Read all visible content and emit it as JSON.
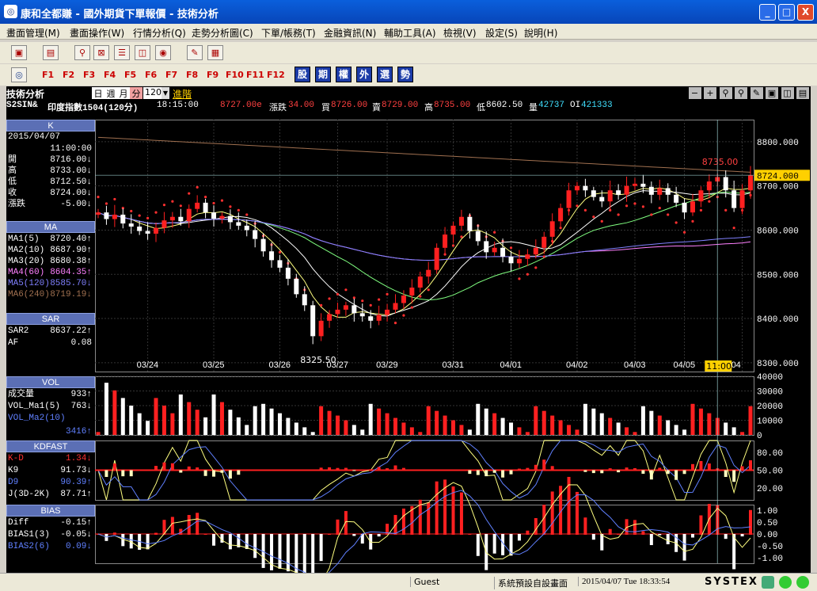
{
  "window": {
    "title": "康和全都賺 - 國外期貨下單報價 - 技術分析",
    "min": "_",
    "max": "□",
    "close": "X"
  },
  "menu": [
    "畫面管理(M)",
    "畫面操作(W)",
    "行情分析(Q)",
    "走勢分析圖(C)",
    "下單/帳務(T)",
    "金融資訊(N)",
    "輔助工具(A)",
    "檢視(V)",
    "設定(S)",
    "說明(H)"
  ],
  "fkeys": [
    "F1",
    "F2",
    "F3",
    "F4",
    "F5",
    "F6",
    "F7",
    "F8",
    "F9",
    "F10",
    "F11",
    "F12"
  ],
  "blue_keys": [
    "股",
    "期",
    "權",
    "外",
    "選",
    "勢"
  ],
  "analysis": {
    "title": "技術分析",
    "periods": [
      "日",
      "週",
      "月",
      "分"
    ],
    "interval": "120",
    "advanced": "進階"
  },
  "quote": {
    "symbol": "S2SIN&",
    "name": "印度指數1504(120分)",
    "time": "18:15:00",
    "last": "8727.00e",
    "change_label": "漲跌",
    "change": "34.00",
    "buy_label": "買",
    "buy": "8726.00",
    "sell_label": "賣",
    "sell": "8729.00",
    "high_label": "高",
    "high": "8735.00",
    "low_label": "低",
    "low": "8602.50",
    "vol_label": "量",
    "vol": "42737",
    "oi_label": "OI",
    "oi": "421333"
  },
  "k_panel": {
    "header": "K",
    "date": "2015/04/07",
    "time": "11:00:00",
    "rows": [
      [
        "開",
        "8716.00↓"
      ],
      [
        "高",
        "8733.00↓"
      ],
      [
        "低",
        "8712.50↓"
      ],
      [
        "收",
        "8724.00↓"
      ],
      [
        "漲跌",
        "-5.00↓"
      ]
    ]
  },
  "ma_panel": {
    "header": "MA",
    "rows": [
      [
        "MA1(5)",
        "8720.40↑",
        "#ffffff"
      ],
      [
        "MA2(10)",
        "8687.90↑",
        "#ffffff"
      ],
      [
        "MA3(20)",
        "8680.38↑",
        "#ffffff"
      ],
      [
        "MA4(60)",
        "8604.35↑",
        "#ff80ff"
      ],
      [
        "MA5(120)",
        "8585.70↓",
        "#8080ff"
      ],
      [
        "MA6(240)",
        "8719.19↓",
        "#a07050"
      ]
    ]
  },
  "sar_panel": {
    "header": "SAR",
    "rows": [
      [
        "SAR2",
        "8637.22↑"
      ],
      [
        "AF",
        "0.08"
      ]
    ]
  },
  "vol_panel": {
    "header": "VOL",
    "rows": [
      [
        "成交量",
        "933↑",
        "#ffffff"
      ],
      [
        "VOL_Ma1(5)",
        "763↓",
        "#ffffff"
      ],
      [
        "VOL_Ma2(10)",
        "",
        "#6080ff"
      ],
      [
        "",
        "3416↑",
        "#6080ff"
      ]
    ]
  },
  "kd_panel": {
    "header": "KDFAST",
    "rows": [
      [
        "K-D",
        "1.34↓",
        "#ff3030"
      ],
      [
        "K9",
        "91.73↓",
        "#ffffff"
      ],
      [
        "D9",
        "90.39↑",
        "#6080ff"
      ],
      [
        "J(3D-2K)",
        "87.71↑",
        "#ffffff"
      ]
    ]
  },
  "bias_panel": {
    "header": "BIAS",
    "rows": [
      [
        "Diff",
        "-0.15↑",
        "#ffffff"
      ],
      [
        "BIAS1(3)",
        "-0.05↓",
        "#ffffff"
      ],
      [
        "BIAS2(6)",
        "0.09↓",
        "#6080ff"
      ]
    ]
  },
  "price_axis": [
    "8800.000",
    "8700.000",
    "8600.000",
    "8500.000",
    "8400.000",
    "8300.000"
  ],
  "price_tag": "8724.000",
  "high_mark": "8735.00",
  "low_mark": "8325.50",
  "date_axis": [
    "03/24",
    "03/25",
    "03/26",
    "03/27",
    "03/29",
    "03/31",
    "04/01",
    "04/02",
    "04/03",
    "04/05",
    "04"
  ],
  "time_tag": "11:00",
  "vol_axis": [
    "40000",
    "30000",
    "20000",
    "10000",
    "0"
  ],
  "kd_axis": [
    "80.00",
    "50.00",
    "20.00"
  ],
  "bias_axis": [
    "1.00",
    "0.50",
    "0.00",
    "-0.50",
    "-1.00"
  ],
  "status": {
    "user": "Guest",
    "screen": "系統預設自設畫面",
    "datetime": "2015/04/07 Tue 18:33:54",
    "brand": "SYSTEX"
  },
  "colors": {
    "up": "#ff2020",
    "down": "#ffffff",
    "sar": "#ff3030",
    "grid": "#3a3a3a",
    "accent": "#ffd000"
  },
  "chart_data": [
    {
      "type": "candlestick",
      "title": "印度指數1504(120分)",
      "ylim": [
        8280,
        8850
      ],
      "x_ticks": [
        "03/24",
        "03/25",
        "03/26",
        "03/27",
        "03/29",
        "03/31",
        "04/01",
        "04/02",
        "04/03",
        "04/05",
        "04"
      ],
      "close": [
        8640,
        8625,
        8635,
        8615,
        8608,
        8598,
        8592,
        8605,
        8622,
        8630,
        8620,
        8648,
        8662,
        8640,
        8626,
        8632,
        8618,
        8610,
        8600,
        8580,
        8552,
        8532,
        8515,
        8490,
        8455,
        8430,
        8360,
        8395,
        8410,
        8420,
        8430,
        8412,
        8405,
        8395,
        8408,
        8420,
        8435,
        8452,
        8470,
        8495,
        8510,
        8560,
        8590,
        8610,
        8630,
        8598,
        8575,
        8550,
        8560,
        8540,
        8525,
        8535,
        8545,
        8560,
        8585,
        8620,
        8650,
        8690,
        8700,
        8690,
        8675,
        8665,
        8690,
        8680,
        8700,
        8705,
        8698,
        8680,
        8695,
        8680,
        8662,
        8640,
        8665,
        8690,
        8710,
        8720,
        8690,
        8650,
        8690,
        8724
      ],
      "high_point": 8735.0,
      "low_point": 8325.5
    },
    {
      "type": "bar",
      "title": "VOL",
      "ylim": [
        0,
        40000
      ],
      "last": 933,
      "ma5": 763,
      "ma10": 3416
    },
    {
      "type": "line",
      "title": "KDFAST",
      "ylim": [
        0,
        100
      ],
      "K9": 91.73,
      "D9": 90.39,
      "J": 87.71
    },
    {
      "type": "line",
      "title": "BIAS",
      "ylim": [
        -1.2,
        1.2
      ],
      "Diff": -0.15,
      "BIAS1": -0.05,
      "BIAS2": 0.09
    }
  ]
}
